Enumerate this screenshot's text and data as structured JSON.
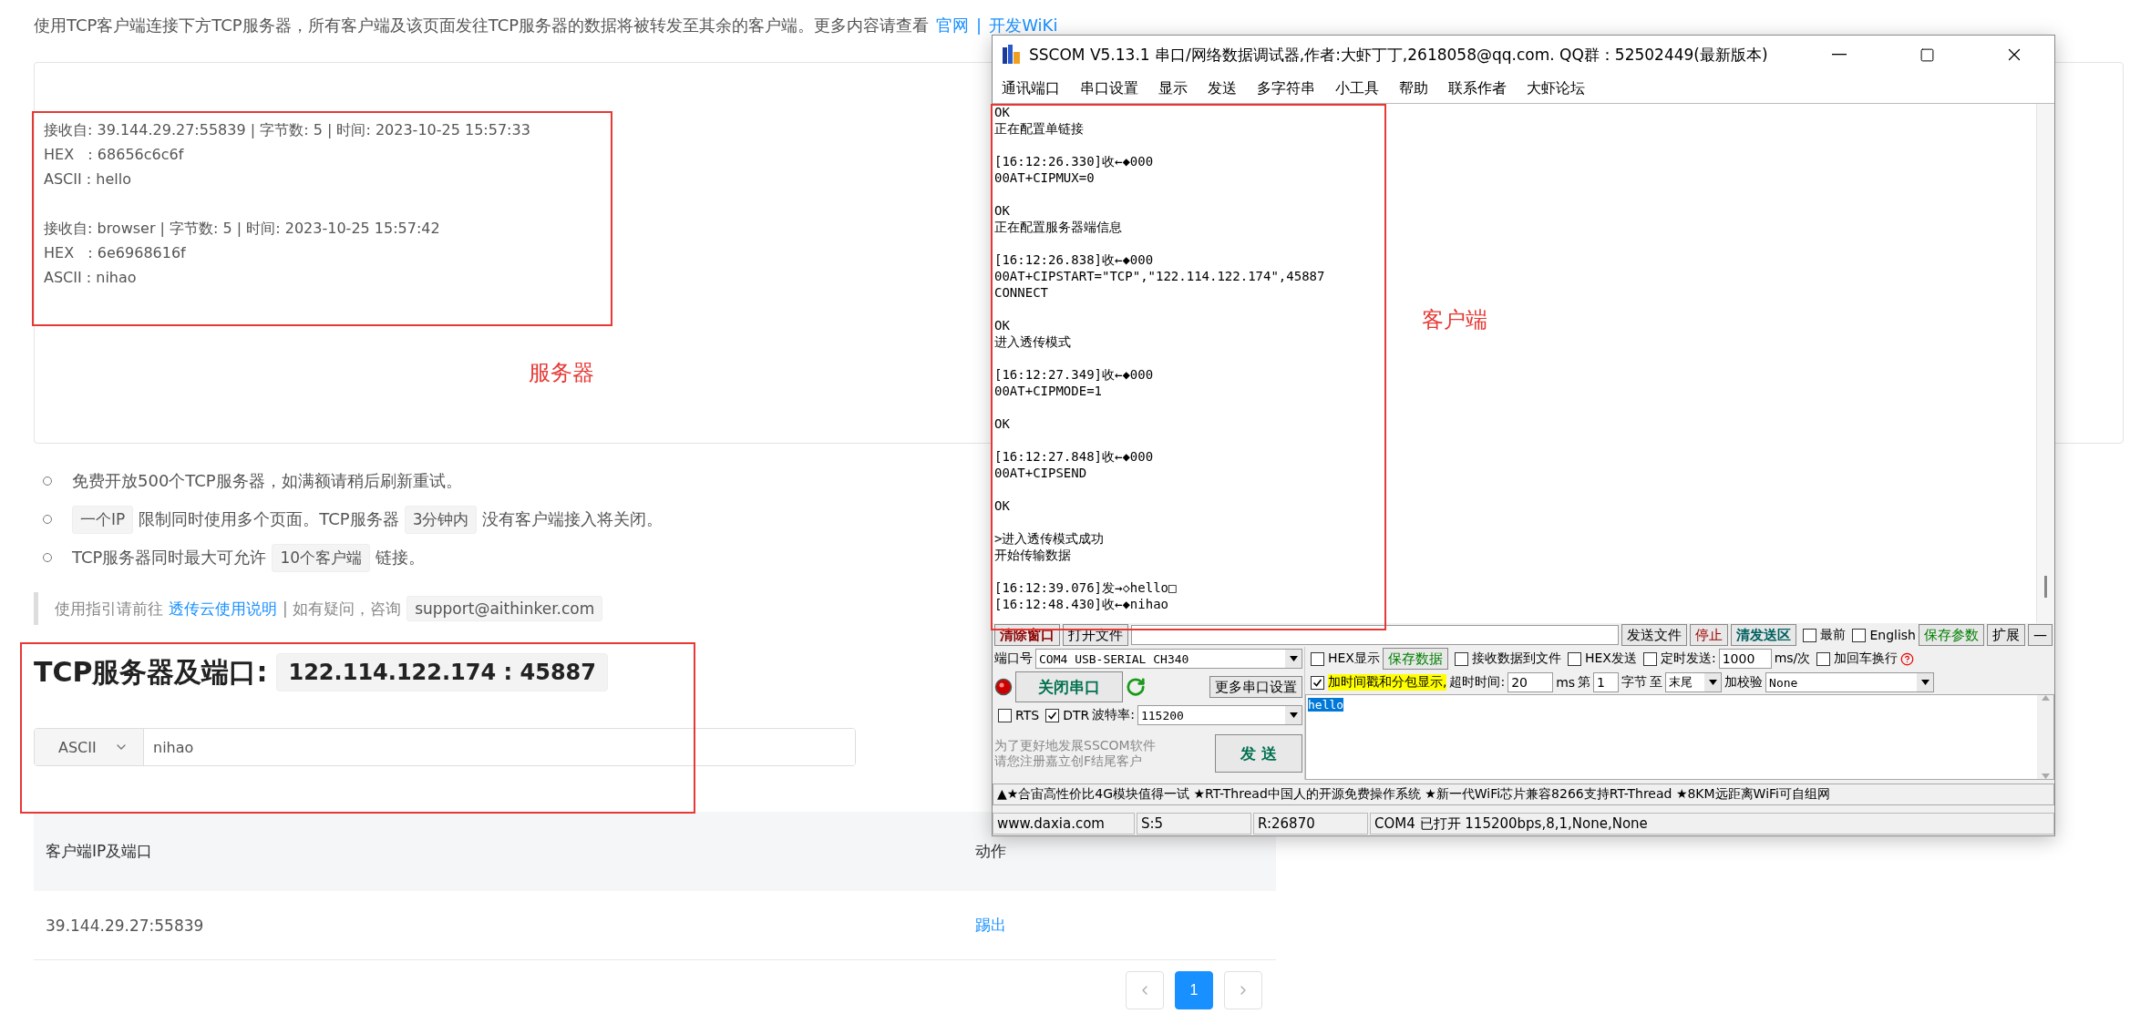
{
  "intro": {
    "text": "使用TCP客户端连接下方TCP服务器，所有客户端及该页面发往TCP服务器的数据将被转发至其余的客户端。更多内容请查看",
    "links": [
      "官网",
      "开发WiKi"
    ],
    "separator": "|"
  },
  "server_log": [
    {
      "lines": [
        "接收自: 39.144.29.27:55839 | 字节数: 5 | 时间: 2023-10-25 15:57:33",
        "HEX   : 68656c6c6f",
        "ASCII : hello"
      ]
    },
    {
      "lines": [
        "接收自: browser | 字节数: 5 | 时间: 2023-10-25 15:57:42",
        "HEX   : 6e6968616f",
        "ASCII : nihao"
      ]
    }
  ],
  "annotations": [
    {
      "text": "服务器"
    },
    {
      "text": "客户端"
    }
  ],
  "notes": [
    [
      {
        "kind": "text",
        "text": "免费开放500个TCP服务器，如满额请稍后刷新重试。"
      }
    ],
    [
      {
        "kind": "code",
        "text": "一个IP"
      },
      {
        "kind": "text",
        "text": "限制同时使用多个页面。TCP服务器"
      },
      {
        "kind": "code",
        "text": "3分钟内"
      },
      {
        "kind": "text",
        "text": "没有客户端接入将关闭。"
      }
    ],
    [
      {
        "kind": "text",
        "text": "TCP服务器同时最大可允许"
      },
      {
        "kind": "code",
        "text": "10个客户端"
      },
      {
        "kind": "text",
        "text": "链接。"
      }
    ]
  ],
  "guide": [
    {
      "kind": "text",
      "text": "使用指引请前往"
    },
    {
      "kind": "link",
      "text": "透传云使用说明"
    },
    {
      "kind": "text",
      "text": "| 如有疑问，咨询"
    },
    {
      "kind": "code",
      "text": "support@aithinker.com"
    }
  ],
  "server": {
    "label": "TCP服务器及端口:",
    "address": "122.114.122.174 : 45887"
  },
  "send": {
    "format": "ASCII",
    "value": "nihao"
  },
  "table": {
    "columns": [
      "客户端IP及端口",
      "动作"
    ],
    "rows": [
      {
        "client": "39.144.29.27:55839",
        "action": "踢出"
      }
    ]
  },
  "pagination": {
    "pages": [
      {
        "label": "1",
        "selected": true
      }
    ]
  },
  "sscom": {
    "title": "SSCOM V5.13.1 串口/网络数据调试器,作者:大虾丁丁,2618058@qq.com. QQ群：52502449(最新版本)",
    "menu": [
      "通讯端口",
      "串口设置",
      "显示",
      "发送",
      "多字符串",
      "小工具",
      "帮助",
      "联系作者",
      "大虾论坛"
    ],
    "log": [
      [
        "OK",
        "正在配置单链接"
      ],
      [
        "[16:12:26.330]收←◆000",
        "00AT+CIPMUX=0"
      ],
      [
        "OK",
        "正在配置服务器端信息"
      ],
      [
        "[16:12:26.838]收←◆000",
        "00AT+CIPSTART=\"TCP\",\"122.114.122.174\",45887",
        "CONNECT"
      ],
      [
        "OK",
        "进入透传模式"
      ],
      [
        "[16:12:27.349]收←◆000",
        "00AT+CIPMODE=1"
      ],
      [
        "OK"
      ],
      [
        "[16:12:27.848]收←◆000",
        "00AT+CIPSEND"
      ],
      [
        "OK"
      ],
      [
        ">进入透传模式成功",
        "开始传输数据"
      ],
      [
        "[16:12:39.076]发→◇hello□",
        "[16:12:48.430]收←◆nihao"
      ]
    ],
    "controls": {
      "clear_button": "清除窗口",
      "open_file_button": "打开文件",
      "send_file_button": "发送文件",
      "stop_button": "停止",
      "clear_send_button": "清发送区",
      "topmost": {
        "label": "最前",
        "checked": false
      },
      "english": {
        "label": "English",
        "checked": false
      },
      "save_params_button": "保存参数",
      "expand_button": "扩展",
      "collapse_button": "—",
      "port": {
        "label": "端口号",
        "value": "COM4 USB-SERIAL CH340"
      },
      "close_port_button": "关闭串口",
      "more_settings_button": "更多串口设置",
      "rts": {
        "label": "RTS",
        "checked": false
      },
      "dtr": {
        "label": "DTR",
        "checked": true
      },
      "baud": {
        "label": "波特率:",
        "value": "115200"
      },
      "promo": [
        "为了更好地发展SSCOM软件",
        "请您注册嘉立创F结尾客户"
      ],
      "send_button": "发 送",
      "hex_display": {
        "label": "HEX显示",
        "checked": false
      },
      "save_data_button": "保存数据",
      "receive_to_file": {
        "label": "接收数据到文件",
        "checked": false
      },
      "hex_send": {
        "label": "HEX发送",
        "checked": false
      },
      "timed_send": {
        "label": "定时发送:",
        "checked": false
      },
      "interval": "1000",
      "interval_unit": "ms/次",
      "append_crlf": {
        "label": "加回车换行",
        "checked": false
      },
      "timestamp": {
        "label": "加时间戳和分包显示,",
        "checked": true
      },
      "timeout_label": "超时时间:",
      "timeout": "20",
      "timeout_unit": "ms",
      "from_label": "第",
      "from": "1",
      "bytes_label": "字节",
      "to_label": "至",
      "to": "末尾",
      "checksum_label": "加校验",
      "checksum": "None",
      "send_text": "hello"
    },
    "ticker": "▲★合宙高性价比4G模块值得一试 ★RT-Thread中国人的开源免费操作系统 ★新一代WiFi芯片兼容8266支持RT-Thread ★8KM远距离WiFi可自组网",
    "status_bar": [
      "www.daxia.com",
      "S:5",
      "R:26870",
      "COM4 已打开  115200bps,8,1,None,None"
    ]
  }
}
